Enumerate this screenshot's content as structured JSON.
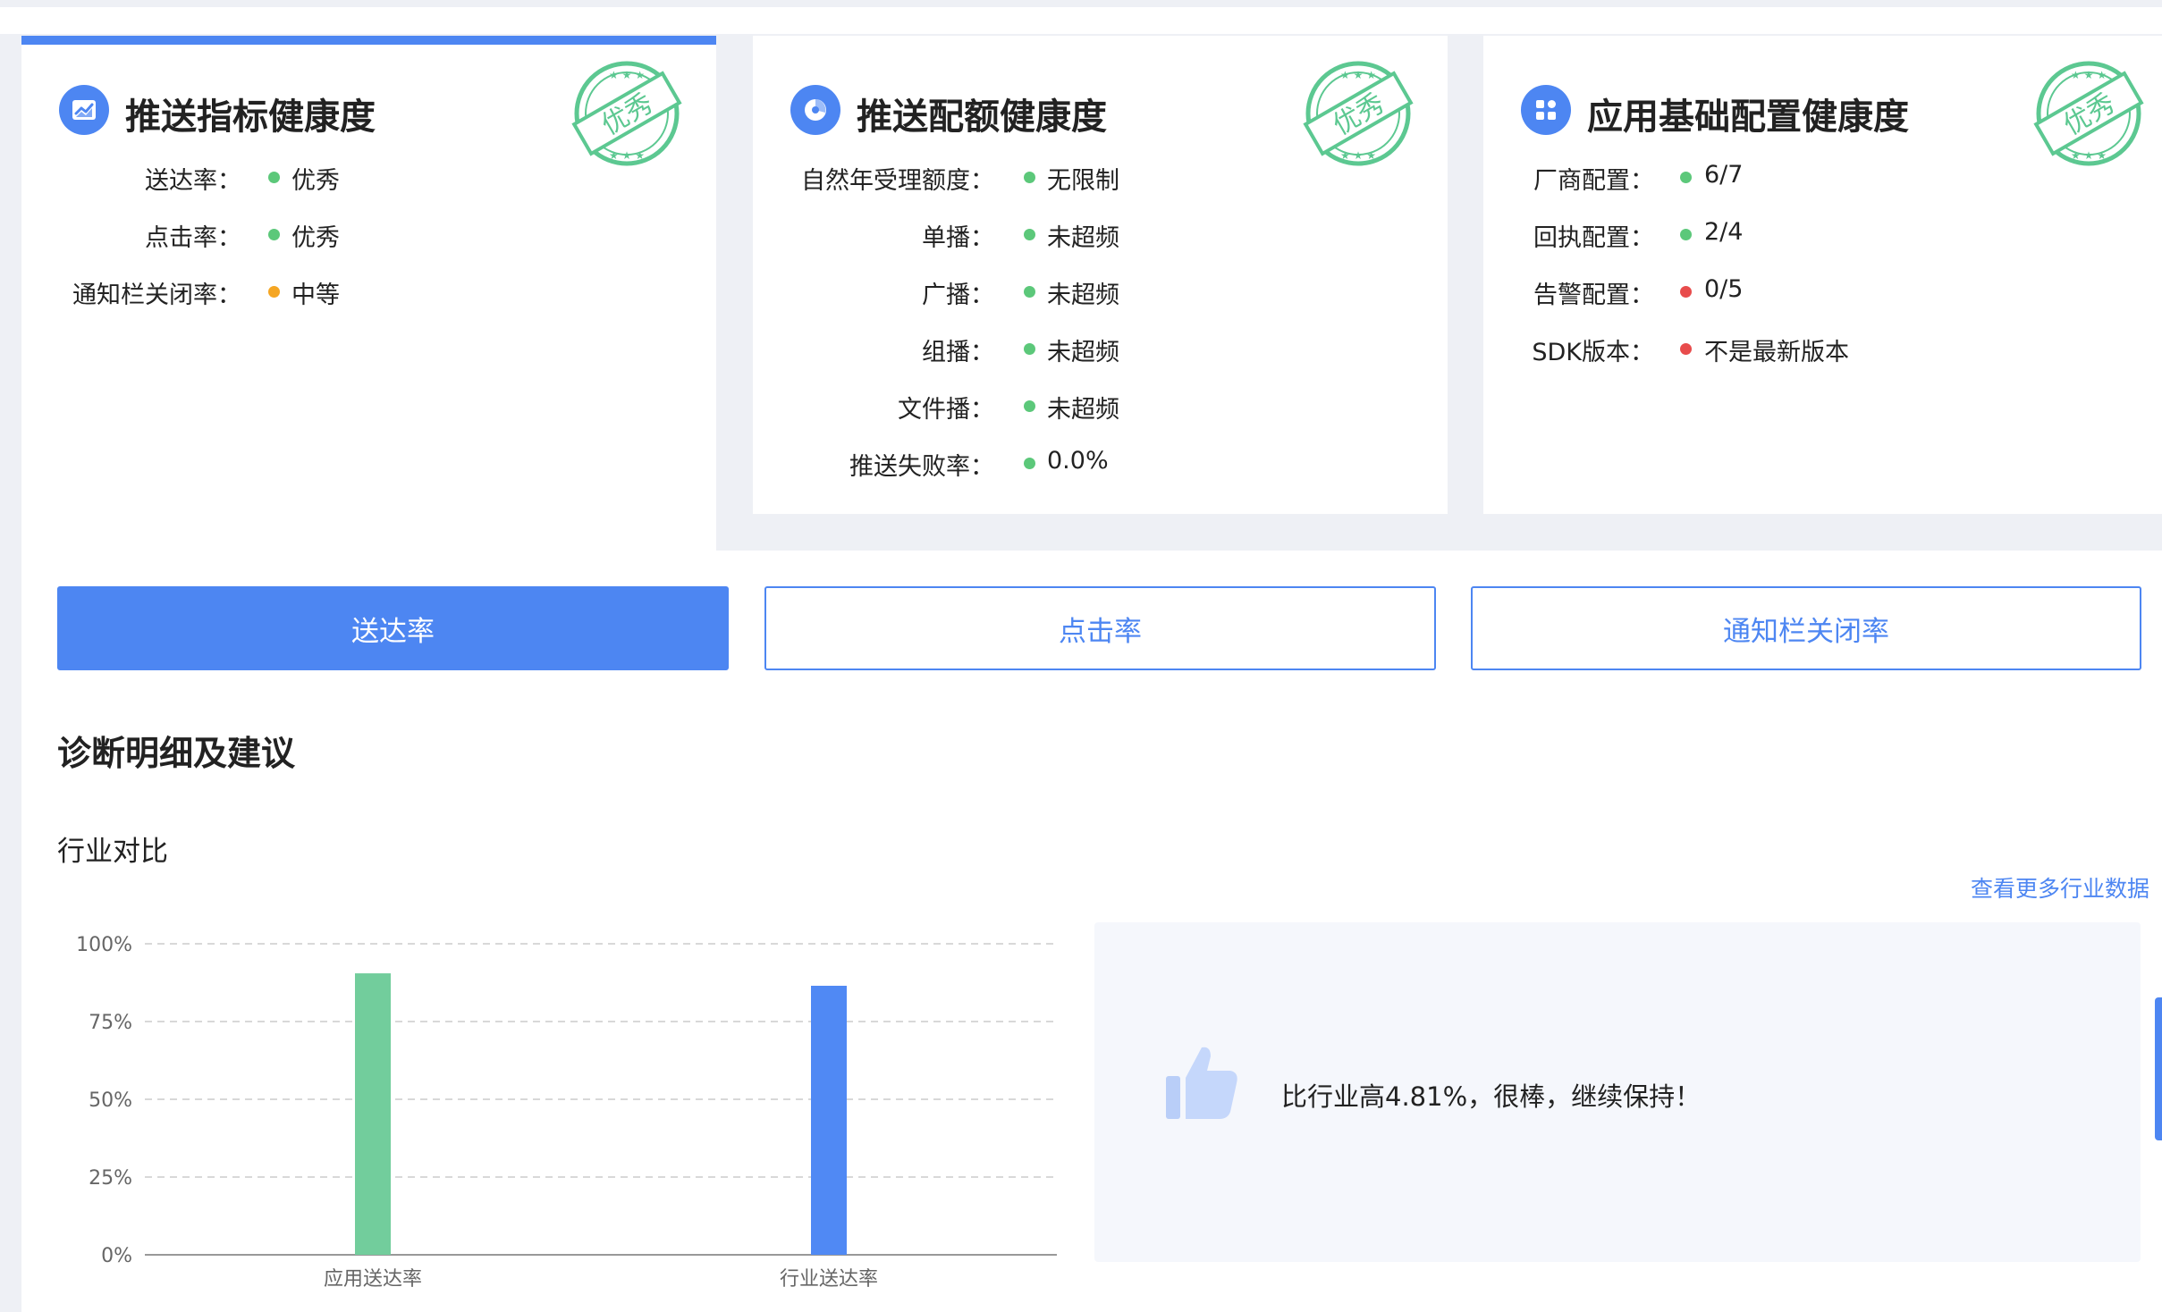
{
  "cards": [
    {
      "title": "推送指标健康度",
      "stamp": "优秀",
      "rows": [
        {
          "label": "送达率：",
          "value": "优秀",
          "status_color": "#5cc87a"
        },
        {
          "label": "点击率：",
          "value": "优秀",
          "status_color": "#5cc87a"
        },
        {
          "label": "通知栏关闭率：",
          "value": "中等",
          "status_color": "#f5a623"
        }
      ]
    },
    {
      "title": "推送配额健康度",
      "stamp": "优秀",
      "rows": [
        {
          "label": "自然年受理额度：",
          "value": "无限制",
          "status_color": "#5cc87a"
        },
        {
          "label": "单播：",
          "value": "未超频",
          "status_color": "#5cc87a"
        },
        {
          "label": "广播：",
          "value": "未超频",
          "status_color": "#5cc87a"
        },
        {
          "label": "组播：",
          "value": "未超频",
          "status_color": "#5cc87a"
        },
        {
          "label": "文件播：",
          "value": "未超频",
          "status_color": "#5cc87a"
        },
        {
          "label": "推送失败率：",
          "value": "0.0%",
          "status_color": "#5cc87a"
        }
      ]
    },
    {
      "title": "应用基础配置健康度",
      "stamp": "优秀",
      "rows": [
        {
          "label": "厂商配置：",
          "value": "6/7",
          "status_color": "#5cc87a"
        },
        {
          "label": "回执配置：",
          "value": "2/4",
          "status_color": "#5cc87a"
        },
        {
          "label": "告警配置：",
          "value": "0/5",
          "status_color": "#e84c4c"
        },
        {
          "label": "SDK版本：",
          "value": "不是最新版本",
          "status_color": "#e84c4c"
        }
      ]
    }
  ],
  "tabs": [
    {
      "label": "送达率",
      "active": true
    },
    {
      "label": "点击率",
      "active": false
    },
    {
      "label": "通知栏关闭率",
      "active": false
    }
  ],
  "section_title": "诊断明细及建议",
  "sub_title": "行业对比",
  "more_link": "查看更多行业数据",
  "chart_data": {
    "type": "bar",
    "categories": [
      "应用送达率",
      "行业送达率"
    ],
    "values": [
      90.5,
      86.5
    ],
    "colors": [
      "#72cd9c",
      "#5089f4"
    ],
    "y_ticks": [
      "0%",
      "25%",
      "50%",
      "75%",
      "100%"
    ],
    "ylim": [
      0,
      100
    ],
    "grid": true
  },
  "advice": {
    "icon": "thumbs-up-icon",
    "text": "比行业高4.81%，很棒，继续保持！"
  },
  "colors": {
    "accent": "#4d86f2",
    "good": "#5cc87a",
    "warn": "#f5a623",
    "bad": "#e84c4c",
    "stamp": "#5cc891"
  }
}
